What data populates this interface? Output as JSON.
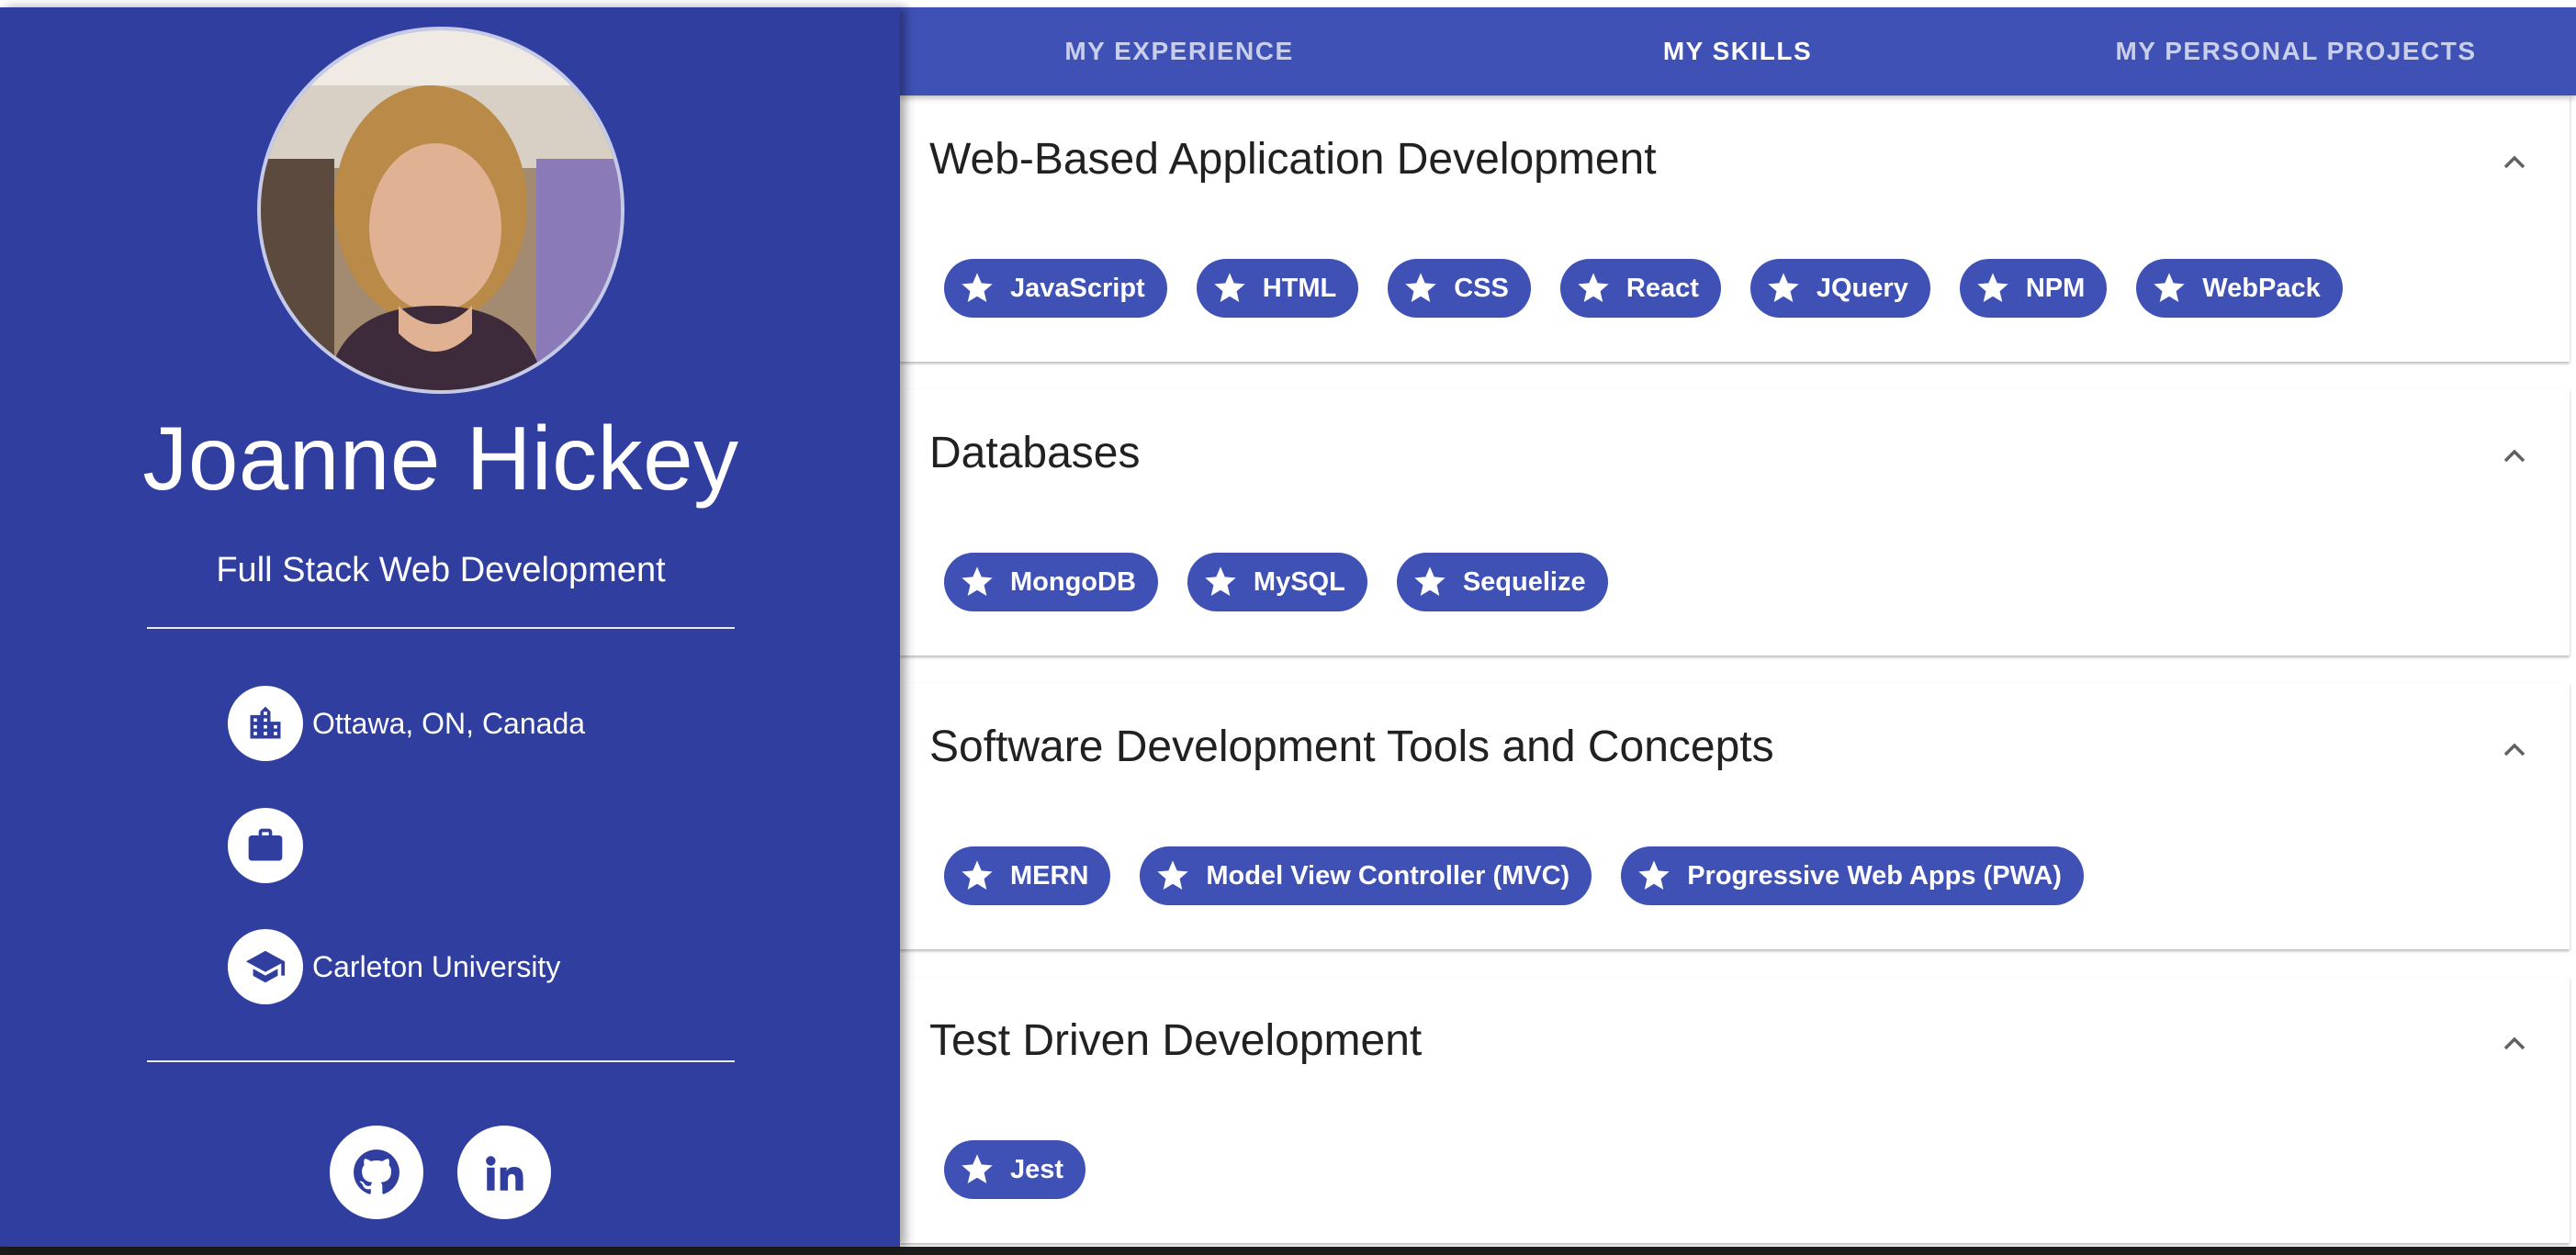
{
  "profile": {
    "name": "Joanne Hickey",
    "title": "Full Stack Web Development",
    "location": "Ottawa, ON, Canada",
    "employer": "",
    "education": "Carleton University"
  },
  "tabs": [
    {
      "label": "MY EXPERIENCE",
      "active": false
    },
    {
      "label": "MY SKILLS",
      "active": true
    },
    {
      "label": "MY PERSONAL PROJECTS",
      "active": false
    }
  ],
  "skills": [
    {
      "title": "Web-Based Application Development",
      "chips": [
        "JavaScript",
        "HTML",
        "CSS",
        "React",
        "JQuery",
        "NPM",
        "WebPack"
      ]
    },
    {
      "title": "Databases",
      "chips": [
        "MongoDB",
        "MySQL",
        "Sequelize"
      ]
    },
    {
      "title": "Software Development Tools and Concepts",
      "chips": [
        "MERN",
        "Model View Controller (MVC)",
        "Progressive Web Apps (PWA)"
      ]
    },
    {
      "title": "Test Driven Development",
      "chips": [
        "Jest"
      ]
    }
  ],
  "icons": {
    "location": "city-icon",
    "employer": "briefcase-icon",
    "education": "graduation-cap-icon",
    "chip": "star-icon",
    "expand": "chevron-up-icon",
    "github": "github-icon",
    "linkedin": "linkedin-icon"
  },
  "colors": {
    "sidebar": "#303f9f",
    "primary": "#3f51b5",
    "tab_indicator": "#f50057",
    "chip": "#3f51b5"
  }
}
